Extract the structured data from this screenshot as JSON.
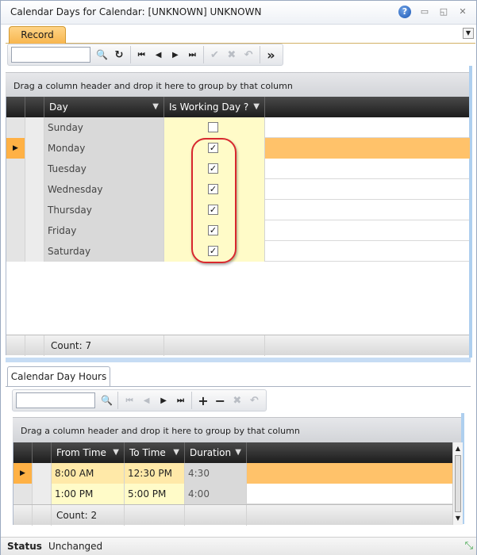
{
  "window": {
    "title": "Calendar Days for Calendar: [UNKNOWN] UNKNOWN",
    "help_glyph": "?",
    "minimize_glyph": "▭",
    "restore_glyph": "◱",
    "close_glyph": "✕"
  },
  "tabs": {
    "record_label": "Record",
    "menu_glyph": "▼"
  },
  "toolbar": {
    "search_value": "",
    "icons": [
      "search-icon",
      "refresh-icon",
      "first-icon",
      "prev-icon",
      "next-icon",
      "last-icon",
      "confirm-icon",
      "cancel-icon",
      "undo-icon",
      "more-icon"
    ],
    "glyphs": {
      "search": "🔍",
      "refresh": "↻",
      "first": "⏮",
      "prev": "◀",
      "next": "▶",
      "last": "⏭",
      "confirm": "✔",
      "cancel": "✖",
      "undo": "↶",
      "more": "»"
    }
  },
  "days_grid": {
    "group_hint": "Drag a column header and drop it here to group by that column",
    "columns": [
      "Day",
      "Is Working Day ?"
    ],
    "filter_glyph": "▼",
    "rows": [
      {
        "day": "Sunday",
        "working": false
      },
      {
        "day": "Monday",
        "working": true
      },
      {
        "day": "Tuesday",
        "working": true
      },
      {
        "day": "Wednesday",
        "working": true
      },
      {
        "day": "Thursday",
        "working": true
      },
      {
        "day": "Friday",
        "working": true
      },
      {
        "day": "Saturday",
        "working": true
      }
    ],
    "selected_row": 1,
    "row_indicator_glyph": "▶",
    "check_glyph": "✓",
    "count_label": "Count: 7"
  },
  "hours_tab": {
    "label": "Calendar Day Hours"
  },
  "hours_toolbar": {
    "search_value": "",
    "glyphs": {
      "search": "🔍",
      "first": "⏮",
      "prev": "◀",
      "next": "▶",
      "last": "⏭",
      "add": "+",
      "remove": "−",
      "cancel": "✖",
      "undo": "↶"
    }
  },
  "hours_grid": {
    "group_hint": "Drag a column header and drop it here to group by that column",
    "columns": [
      "From Time",
      "To Time",
      "Duration"
    ],
    "rows": [
      {
        "from": "8:00 AM",
        "to": "12:30 PM",
        "duration": "4:30"
      },
      {
        "from": "1:00 PM",
        "to": "5:00 PM",
        "duration": "4:00"
      }
    ],
    "selected_row": 0,
    "count_label": "Count: 2"
  },
  "status": {
    "label": "Status",
    "value": "Unchanged",
    "resize_glyph": "⤡"
  },
  "colors": {
    "accent_orange": "#ffc26a",
    "selected_indicator": "#ffb145",
    "annotation_red": "#d8282e",
    "working_cell_yellow": "#fffbc8"
  }
}
